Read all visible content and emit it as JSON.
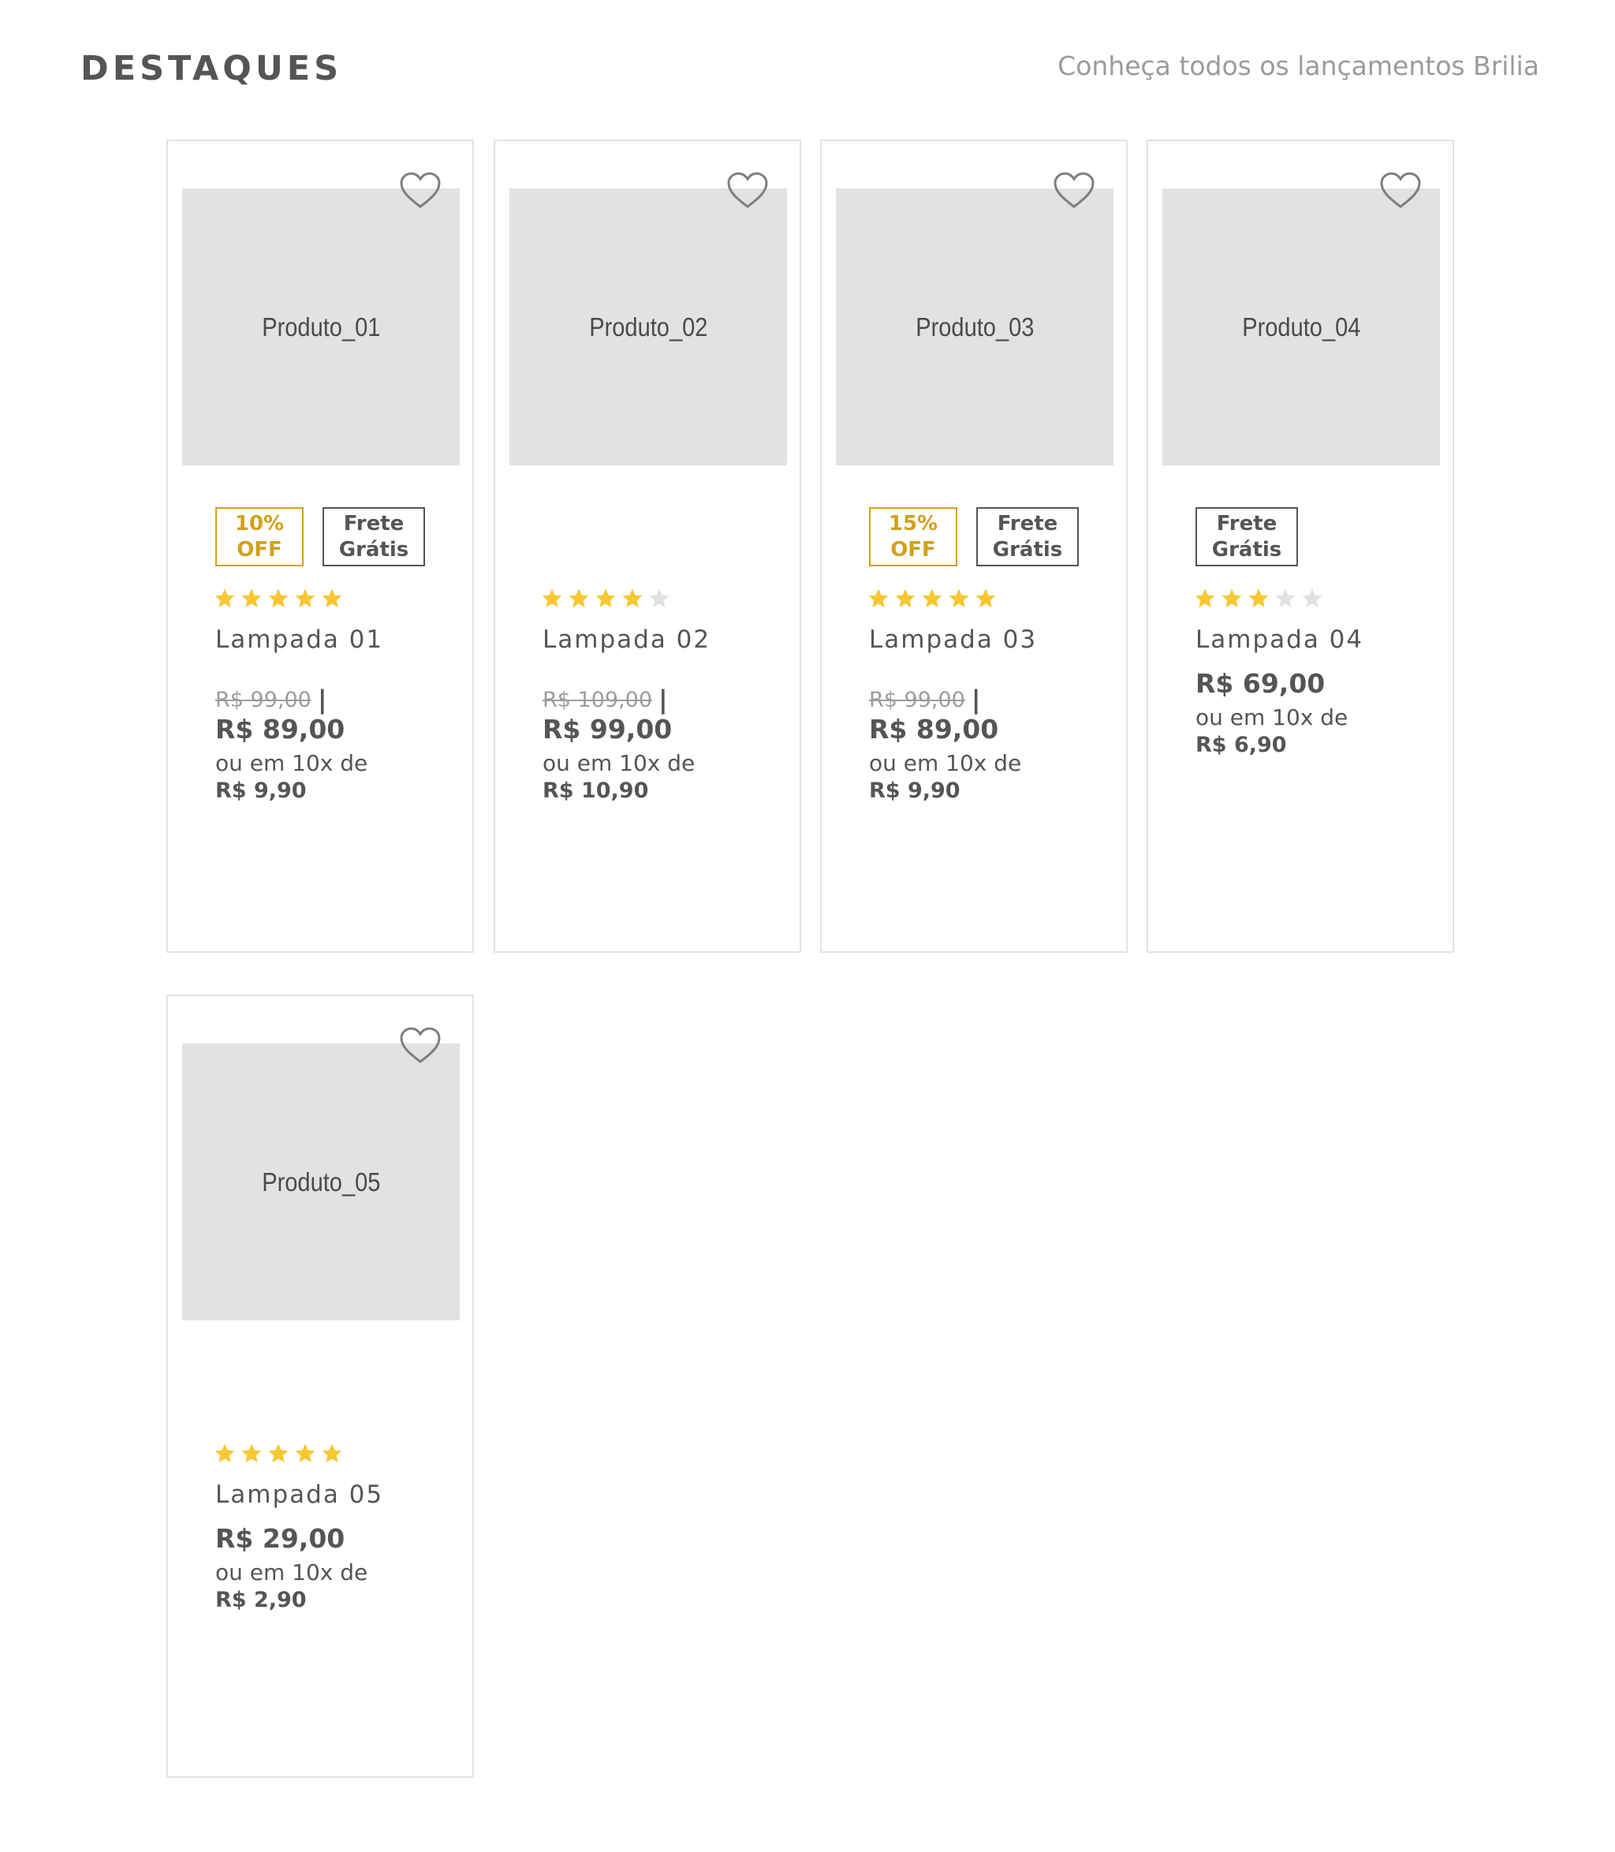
{
  "section": {
    "title": "DESTAQUES",
    "link": "Conheça todos os lançamentos Brilia"
  },
  "colors": {
    "accent": "#d3a01c",
    "star_on": "#f8c731",
    "star_off": "#e1e1e1",
    "image_placeholder": "#e2e2e2",
    "text": "#555555",
    "muted": "#9d9d9d",
    "border": "#e3e3e3"
  },
  "products": [
    {
      "image_label": "Produto_01",
      "badges": {
        "discount_pct": "10%",
        "discount_off": "OFF",
        "shipping_1": "Frete",
        "shipping_2": "Grátis"
      },
      "rating": 5,
      "name": "Lampada 01",
      "old_price": "R$ 99,00",
      "separator": "|",
      "price": "R$ 89,00",
      "installment_label": "ou em 10x de",
      "installment_value": "R$ 9,90"
    },
    {
      "image_label": "Produto_02",
      "rating": 4,
      "name": "Lampada 02",
      "old_price": "R$ 109,00",
      "separator": "|",
      "price": "R$ 99,00",
      "installment_label": "ou em 10x de",
      "installment_value": "R$ 10,90"
    },
    {
      "image_label": "Produto_03",
      "badges": {
        "discount_pct": "15%",
        "discount_off": "OFF",
        "shipping_1": "Frete",
        "shipping_2": "Grátis"
      },
      "rating": 5,
      "name": "Lampada 03",
      "old_price": "R$ 99,00",
      "separator": "|",
      "price": "R$ 89,00",
      "installment_label": "ou em 10x de",
      "installment_value": "R$ 9,90"
    },
    {
      "image_label": "Produto_04",
      "badges": {
        "shipping_1": "Frete",
        "shipping_2": "Grátis"
      },
      "rating": 3,
      "name": "Lampada 04",
      "price": "R$ 69,00",
      "installment_label": "ou em 10x de",
      "installment_value": "R$ 6,90"
    },
    {
      "image_label": "Produto_05",
      "rating": 5,
      "name": "Lampada 05",
      "price": "R$ 29,00",
      "installment_label": "ou em 10x de",
      "installment_value": "R$ 2,90"
    }
  ]
}
